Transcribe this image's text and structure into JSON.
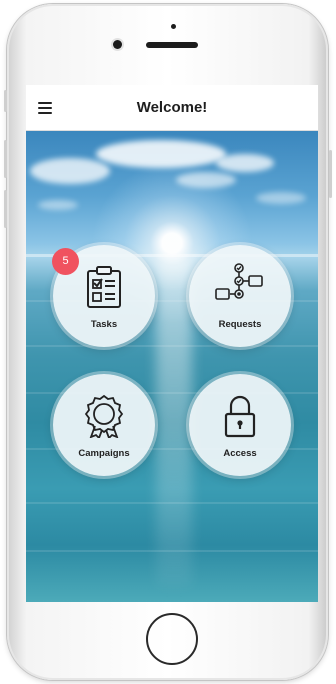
{
  "header": {
    "title": "Welcome!",
    "menu_icon": "hamburger-menu-icon"
  },
  "tiles": [
    {
      "label": "Tasks",
      "icon": "clipboard-checklist-icon",
      "badge": "5"
    },
    {
      "label": "Requests",
      "icon": "workflow-process-icon"
    },
    {
      "label": "Campaigns",
      "icon": "award-ribbon-icon"
    },
    {
      "label": "Access",
      "icon": "padlock-icon"
    }
  ],
  "colors": {
    "badge": "#f0525f",
    "header_background": "#ffffff",
    "tile_background": "#f0f6f9"
  }
}
